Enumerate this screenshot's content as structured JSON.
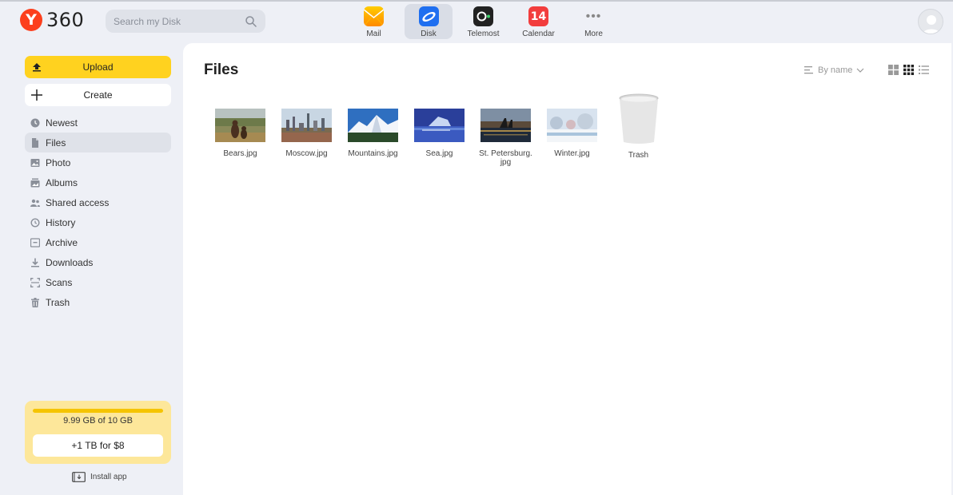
{
  "header": {
    "logo_letter": "Y",
    "logo_text": "360",
    "search_placeholder": "Search my Disk",
    "apps": [
      {
        "label": "Mail",
        "icon": "mail-icon"
      },
      {
        "label": "Disk",
        "icon": "disk-icon",
        "active": true
      },
      {
        "label": "Telemost",
        "icon": "telemost-icon"
      },
      {
        "label": "Calendar",
        "icon": "calendar-icon",
        "badge": "14"
      },
      {
        "label": "More",
        "icon": "more-icon"
      }
    ]
  },
  "sidebar": {
    "upload_label": "Upload",
    "create_label": "Create",
    "items": [
      {
        "label": "Newest",
        "icon": "clock-icon"
      },
      {
        "label": "Files",
        "icon": "file-icon",
        "active": true
      },
      {
        "label": "Photo",
        "icon": "photo-icon"
      },
      {
        "label": "Albums",
        "icon": "album-icon"
      },
      {
        "label": "Shared access",
        "icon": "people-icon"
      },
      {
        "label": "History",
        "icon": "history-icon"
      },
      {
        "label": "Archive",
        "icon": "archive-icon"
      },
      {
        "label": "Downloads",
        "icon": "download-icon"
      },
      {
        "label": "Scans",
        "icon": "scan-icon"
      },
      {
        "label": "Trash",
        "icon": "trash-icon"
      }
    ],
    "storage": {
      "used_text": "9.99 GB of 10 GB",
      "used_fraction": 0.999,
      "upgrade_label": "+1 TB for $8"
    },
    "install_label": "Install app"
  },
  "main": {
    "title": "Files",
    "sort_label": "By name",
    "files": [
      {
        "name": "Bears.jpg"
      },
      {
        "name": "Moscow.jpg"
      },
      {
        "name": "Mountains.jpg"
      },
      {
        "name": "Sea.jpg"
      },
      {
        "name": "St. Petersburg.\njpg"
      },
      {
        "name": "Winter.jpg"
      },
      {
        "name": "Trash"
      }
    ]
  },
  "colors": {
    "accent_yellow": "#ffd21f",
    "yandex_red": "#fc3f1d",
    "disk_blue": "#1f6ff0",
    "sidebar_bg": "#eef0f6"
  }
}
